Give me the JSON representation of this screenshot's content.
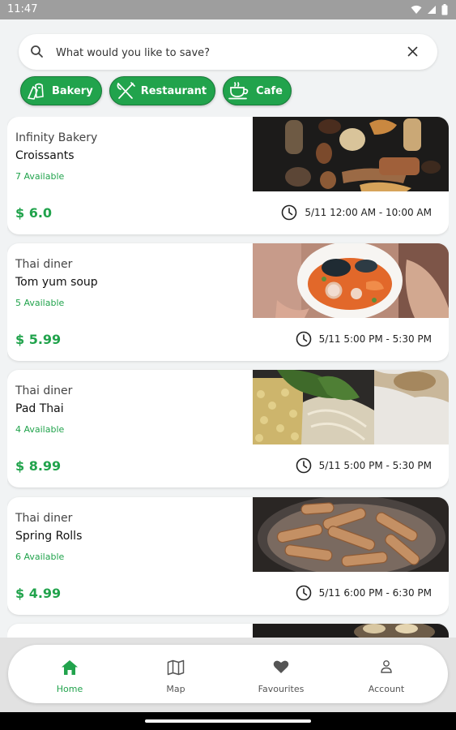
{
  "status_bar": {
    "time": "11:47"
  },
  "search": {
    "placeholder": "What would you like to save?",
    "value": ""
  },
  "filters": [
    {
      "label": "Bakery",
      "icon": "bakery-icon"
    },
    {
      "label": "Restaurant",
      "icon": "restaurant-icon"
    },
    {
      "label": "Cafe",
      "icon": "cafe-icon"
    }
  ],
  "listings": [
    {
      "store": "Infinity Bakery",
      "item": "Croissants",
      "available": "7 Available",
      "price": "$ 6.0",
      "pickup": "5/11 12:00 AM - 10:00 AM",
      "photo": "bakery-assortment-photo"
    },
    {
      "store": "Thai diner",
      "item": "Tom yum soup",
      "available": "5 Available",
      "price": "$ 5.99",
      "pickup": "5/11 5:00 PM - 5:30 PM",
      "photo": "seafood-soup-plate-photo"
    },
    {
      "store": "Thai diner",
      "item": "Pad Thai",
      "available": "4 Available",
      "price": "$ 8.99",
      "pickup": "5/11 5:00 PM - 5:30 PM",
      "photo": "noodles-and-greens-photo"
    },
    {
      "store": "Thai diner",
      "item": "Spring Rolls",
      "available": "6 Available",
      "price": "$ 4.99",
      "pickup": "5/11 6:00 PM - 6:30 PM",
      "photo": "spring-rolls-pan-photo"
    }
  ],
  "bottom_nav": [
    {
      "label": "Home",
      "icon": "home-icon",
      "active": true
    },
    {
      "label": "Map",
      "icon": "map-icon",
      "active": false
    },
    {
      "label": "Favourites",
      "icon": "heart-icon",
      "active": false
    },
    {
      "label": "Account",
      "icon": "person-icon",
      "active": false
    }
  ],
  "colors": {
    "accent": "#21a34c",
    "background": "#f1f3f4",
    "status_bar": "#9e9e9e"
  }
}
